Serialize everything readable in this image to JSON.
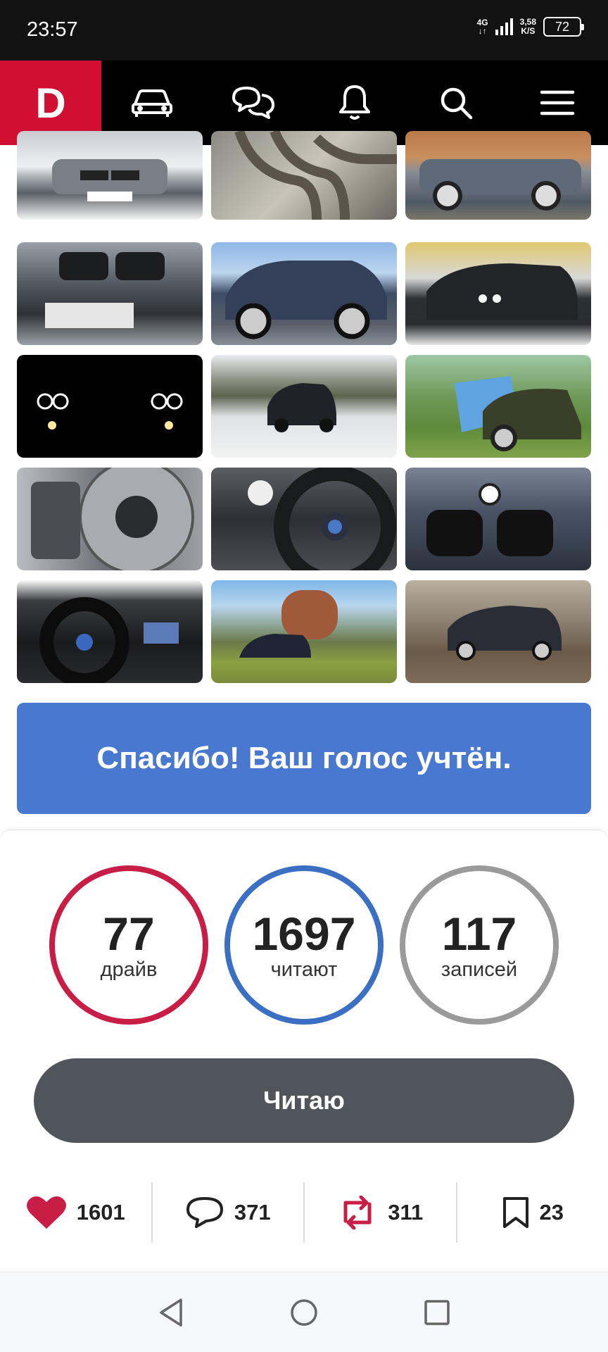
{
  "status_bar": {
    "time": "23:57",
    "network": "4G",
    "speed": "3,58",
    "speed_unit": "K/S",
    "battery": "72"
  },
  "nav": {
    "logo": "D",
    "items": [
      "car-icon",
      "chat-icon",
      "bell-icon",
      "search-icon",
      "menu-icon"
    ]
  },
  "photos": [
    "bmw-x5-front-snow",
    "exhaust-headers",
    "bmw-x5-side-silver",
    "bmw-x5-grille-closeup",
    "bmw-x5-rear-blue",
    "bmw-x5-black-parking",
    "bmw-x5-night-angel-eyes",
    "bmw-x5-snow-road",
    "bmw-x5-flag-field",
    "brake-disc",
    "steering-wheel",
    "bmw-emblem-hood",
    "dashboard-interior",
    "bmw-x5-tank-car",
    "bmw-x5-sand"
  ],
  "vote_message": "Спасибо! Ваш голос учтён.",
  "stats": [
    {
      "value": "77",
      "label": "драйв",
      "color": "#c81e45"
    },
    {
      "value": "1697",
      "label": "читают",
      "color": "#3a6fc4"
    },
    {
      "value": "117",
      "label": "записей",
      "color": "#9a9a9a"
    }
  ],
  "follow_button": "Читаю",
  "actions": {
    "likes": "1601",
    "comments": "371",
    "reposts": "311",
    "bookmarks": "23"
  },
  "colors": {
    "brand": "#d10f32",
    "vote_bg": "#4878cf",
    "button_bg": "#4f555b"
  }
}
